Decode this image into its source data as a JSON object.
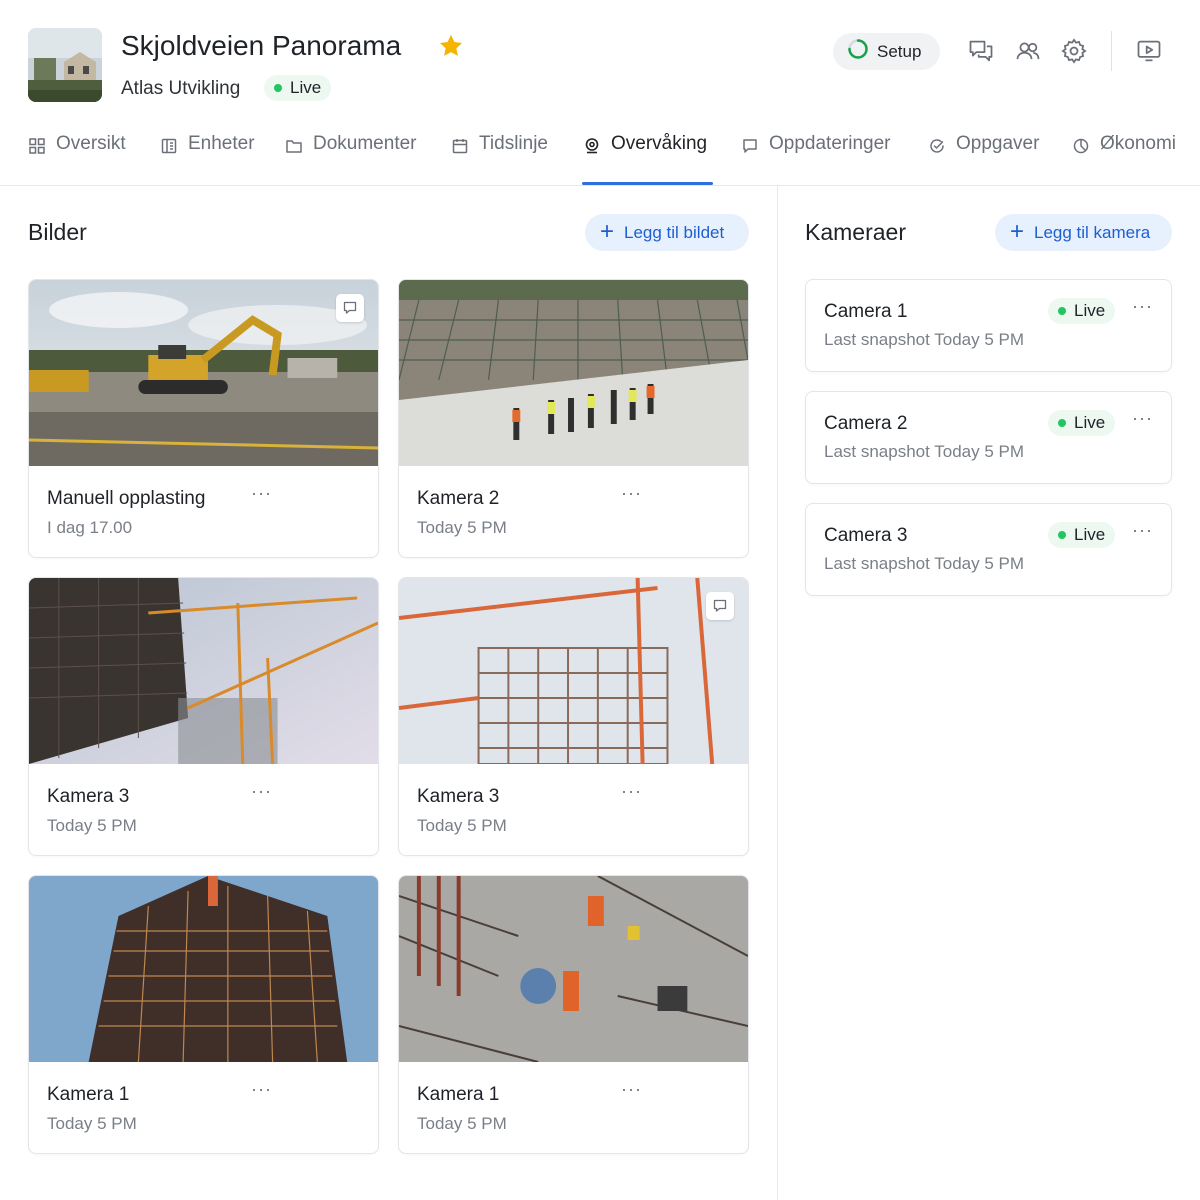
{
  "project": {
    "title": "Skjoldveien Panorama",
    "company": "Atlas Utvikling",
    "status": "Live",
    "favorite_icon": "star-icon",
    "setup_label": "Setup"
  },
  "header_actions": [
    "chat-icon",
    "users-icon",
    "settings-icon",
    "presentation-icon"
  ],
  "tabs": [
    {
      "label": "Oversikt",
      "icon": "grid-icon"
    },
    {
      "label": "Enheter",
      "icon": "units-icon"
    },
    {
      "label": "Dokumenter",
      "icon": "folder-icon"
    },
    {
      "label": "Tidslinje",
      "icon": "calendar-icon"
    },
    {
      "label": "Overvåking",
      "icon": "webcam-icon",
      "active": true
    },
    {
      "label": "Oppdateringer",
      "icon": "message-icon"
    },
    {
      "label": "Oppgaver",
      "icon": "task-icon"
    },
    {
      "label": "Økonomi",
      "icon": "pie-chart-icon"
    }
  ],
  "photos": {
    "title": "Bilder",
    "add_label": "Legg til bildet",
    "items": [
      {
        "title": "Manuell opplasting",
        "time": "I dag 17.00",
        "has_comment": true
      },
      {
        "title": "Kamera 2",
        "time": "Today 5 PM",
        "has_comment": false
      },
      {
        "title": "Kamera 3",
        "time": "Today 5 PM",
        "has_comment": false
      },
      {
        "title": "Kamera 3",
        "time": "Today 5 PM",
        "has_comment": true
      },
      {
        "title": "Kamera 1",
        "time": "Today 5 PM",
        "has_comment": false
      },
      {
        "title": "Kamera 1",
        "time": "Today 5 PM",
        "has_comment": false
      }
    ],
    "more_label": "···"
  },
  "cameras": {
    "title": "Kameraer",
    "add_label": "Legg til kamera",
    "items": [
      {
        "name": "Camera 1",
        "snapshot": "Last snapshot Today 5 PM",
        "status": "Live"
      },
      {
        "name": "Camera 2",
        "snapshot": "Last snapshot Today 5 PM",
        "status": "Live"
      },
      {
        "name": "Camera 3",
        "snapshot": "Last snapshot Today 5 PM",
        "status": "Live"
      }
    ]
  },
  "colors": {
    "accent": "#2f6fde",
    "live_green": "#22c55e",
    "star": "#f5b400"
  }
}
